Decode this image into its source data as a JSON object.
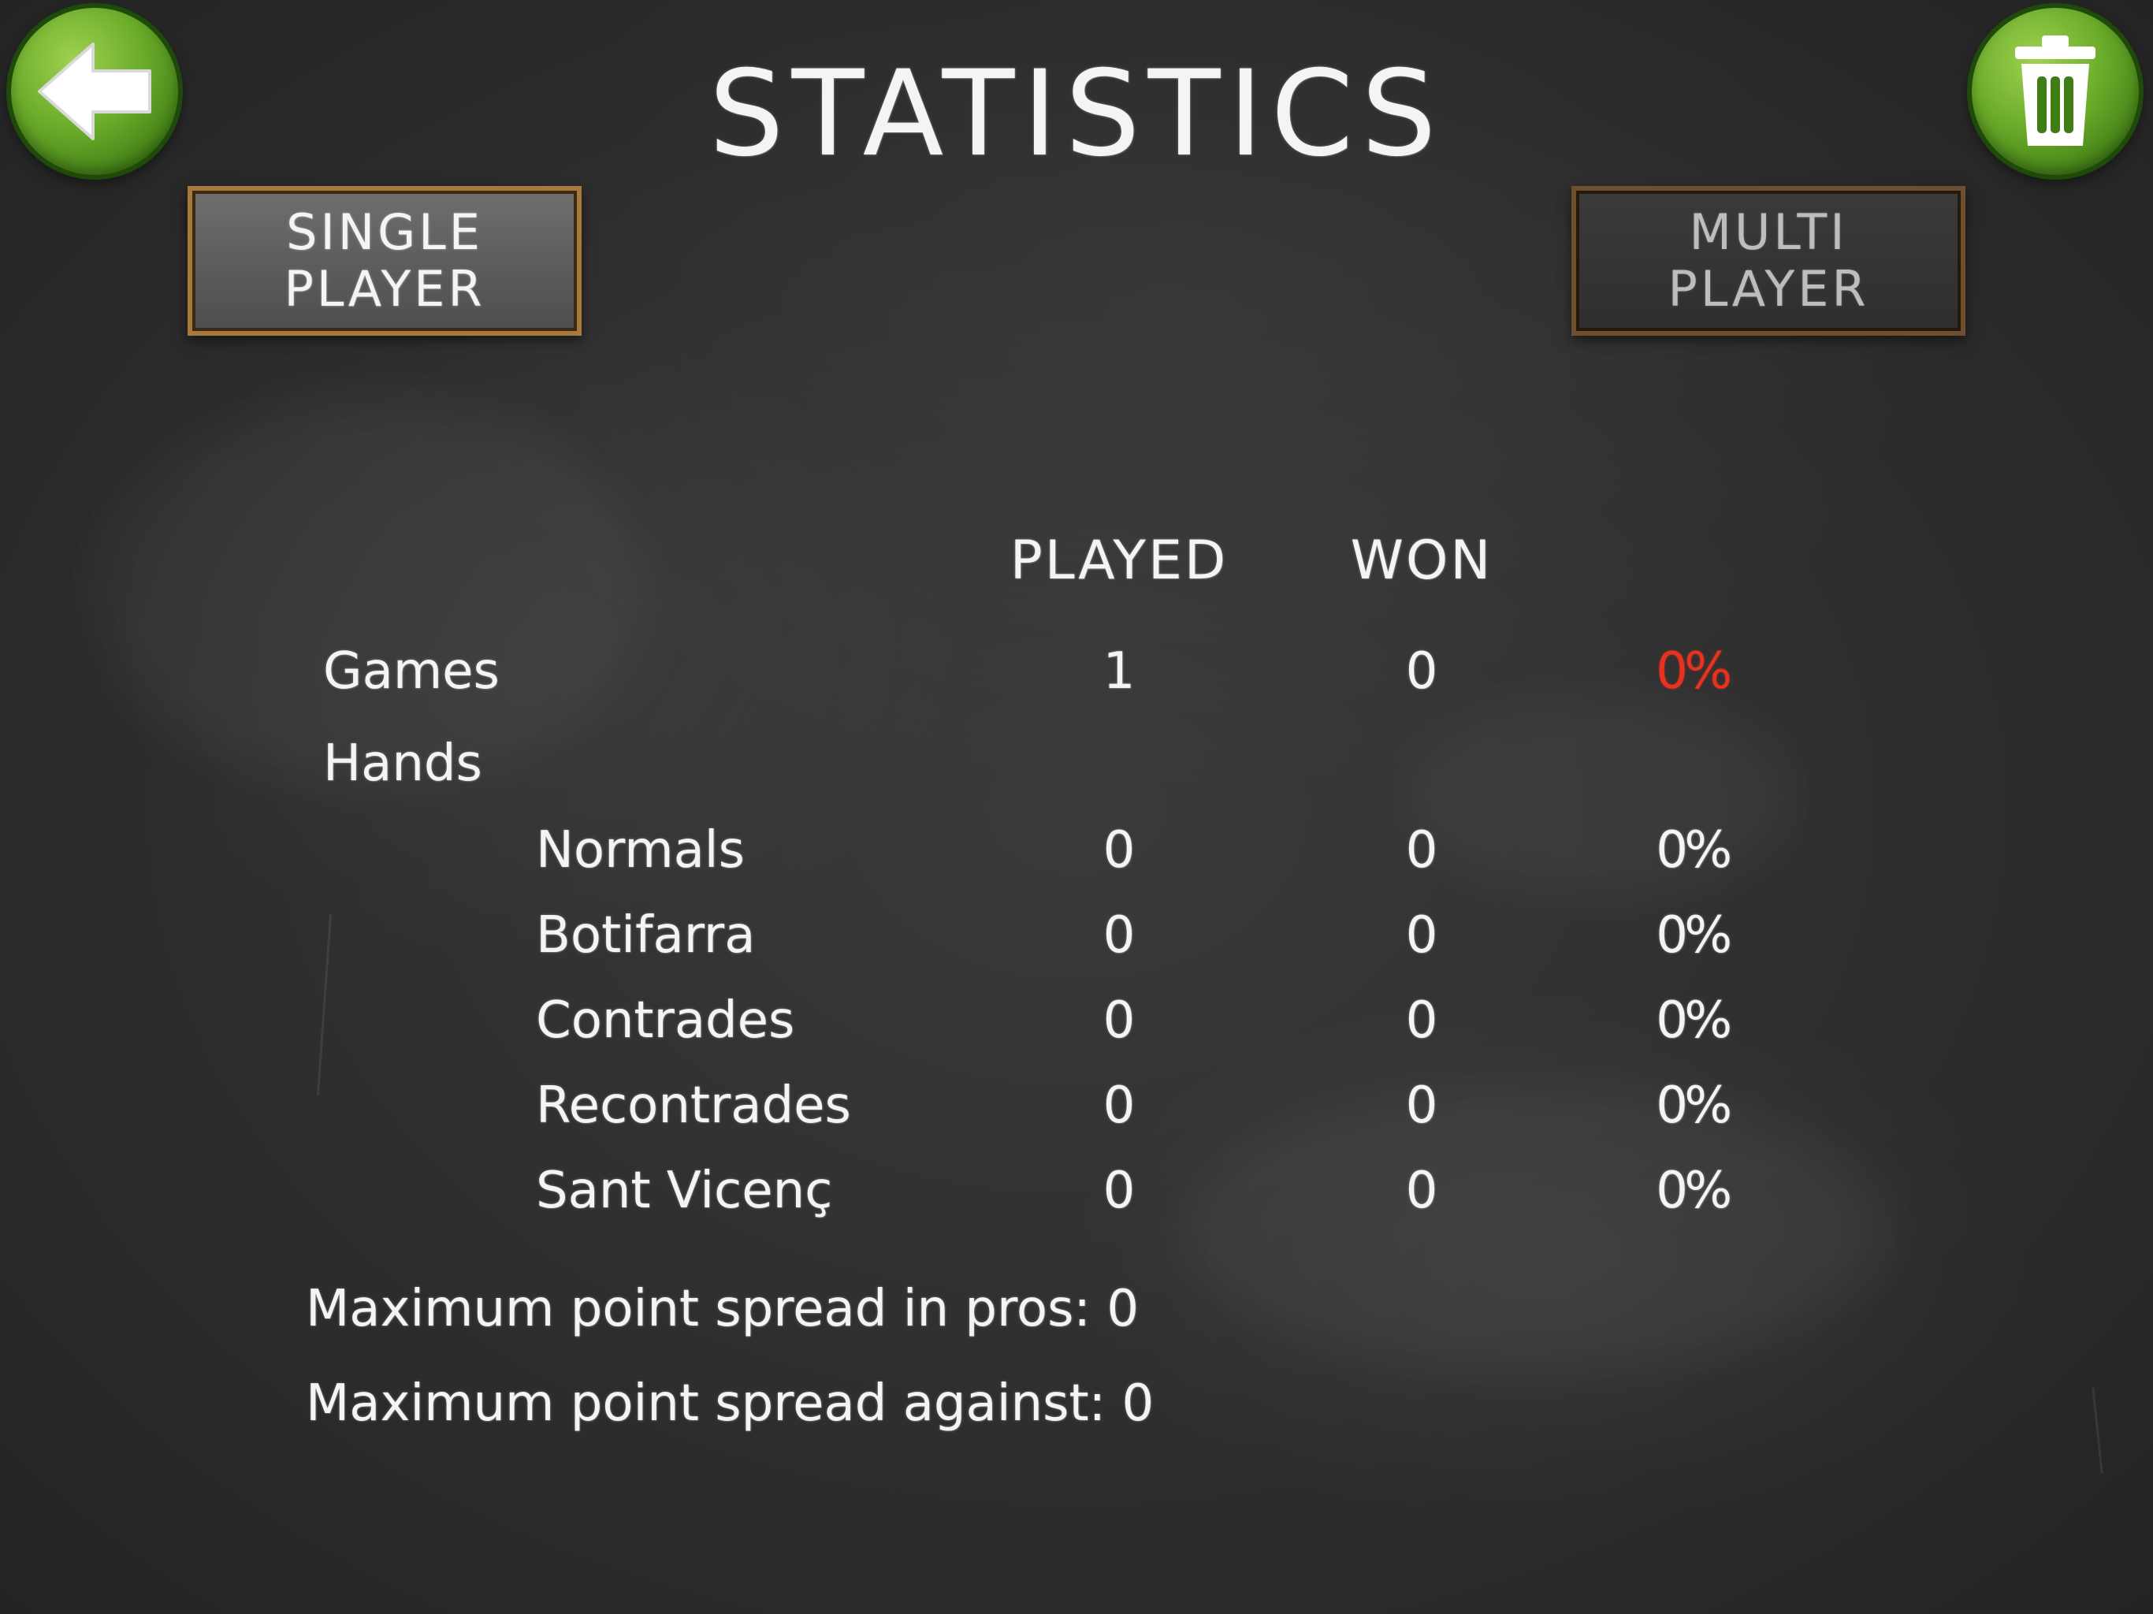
{
  "header": {
    "title": "STATISTICS",
    "back_icon": "arrow-left-icon",
    "trash_icon": "trash-icon"
  },
  "tabs": [
    {
      "label": "SINGLE\nPLAYER",
      "selected": true
    },
    {
      "label": "MULTI\nPLAYER",
      "selected": false
    }
  ],
  "columns": {
    "played": "PLAYED",
    "won": "WON"
  },
  "games": {
    "label": "Games",
    "played": "1",
    "won": "0",
    "percent": "0",
    "percent_sign": "%"
  },
  "hands": {
    "label": "Hands",
    "rows": [
      {
        "label": "Normals",
        "played": "0",
        "won": "0",
        "percent": "0",
        "percent_sign": "%"
      },
      {
        "label": "Botifarra",
        "played": "0",
        "won": "0",
        "percent": "0",
        "percent_sign": "%"
      },
      {
        "label": "Contrades",
        "played": "0",
        "won": "0",
        "percent": "0",
        "percent_sign": "%"
      },
      {
        "label": "Recontrades",
        "played": "0",
        "won": "0",
        "percent": "0",
        "percent_sign": "%"
      },
      {
        "label": "Sant Vicenç",
        "played": "0",
        "won": "0",
        "percent": "0",
        "percent_sign": "%"
      }
    ]
  },
  "spread": {
    "pros_label": "Maximum point spread in pros:",
    "pros_value": "0",
    "against_label": "Maximum point spread against:",
    "against_value": "0"
  },
  "colors": {
    "accent_green": "#6aab2a",
    "highlight_red": "#e8321f",
    "board": "#2e2e2e",
    "frame": "#a8793f"
  }
}
